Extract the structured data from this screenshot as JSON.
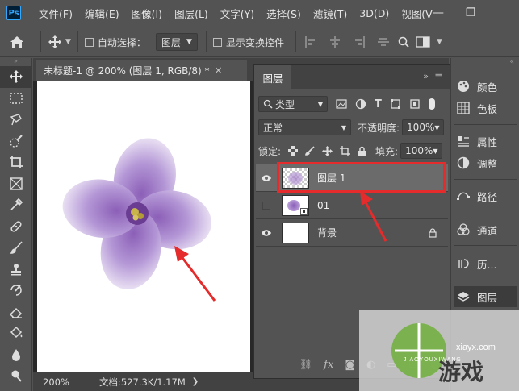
{
  "menubar": {
    "logo": "Ps",
    "items": [
      "文件(F)",
      "编辑(E)",
      "图像(I)",
      "图层(L)",
      "文字(Y)",
      "选择(S)",
      "滤镜(T)",
      "3D(D)",
      "视图(V"
    ],
    "minimize": "—",
    "maximize": "❐"
  },
  "options": {
    "auto_select_label": "自动选择：",
    "auto_select_target": "图层",
    "show_transform_label": "显示变换控件"
  },
  "document": {
    "tab_title": "未标题-1 @ 200% (图层 1, RGB/8) *",
    "tab_close": "×",
    "zoom": "200%",
    "doc_info": "文档:527.3K/1.17M"
  },
  "layers_panel": {
    "tab": "图层",
    "filter_kind": "类型",
    "blend_mode": "正常",
    "opacity_label": "不透明度:",
    "opacity_value": "100%",
    "lock_label": "锁定:",
    "fill_label": "填充:",
    "fill_value": "100%",
    "layers": [
      {
        "name": "图层 1",
        "visible": true,
        "selected": true
      },
      {
        "name": "01",
        "visible": false,
        "selected": false
      },
      {
        "name": "背景",
        "visible": true,
        "selected": false,
        "locked": true
      }
    ]
  },
  "dock": {
    "items": [
      "颜色",
      "色板",
      "属性",
      "调整",
      "路径",
      "通道",
      "历...",
      "图层"
    ]
  },
  "watermark": {
    "brand": "游戏",
    "site": "xiayx.com",
    "sub": "JIAOYOUXIWANG"
  },
  "colors": {
    "accent": "#31a8ff",
    "highlight_red": "#e52b2b",
    "panel_bg": "#535353"
  }
}
